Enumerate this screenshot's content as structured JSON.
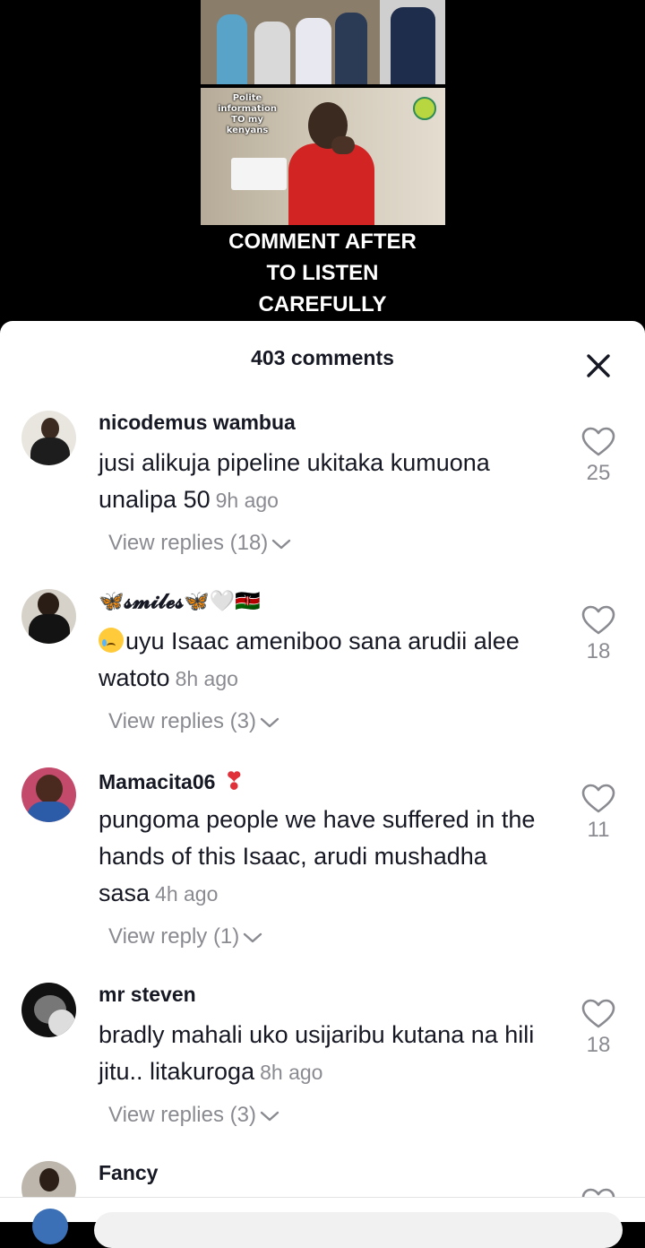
{
  "video": {
    "thumb_top_alt": "",
    "overlay_title_line1": "Polite information",
    "overlay_title_line2": "TO my kenyans",
    "caption_lines": [
      "COMMENT AFTER",
      "TO LISTEN",
      "CAREFULLY"
    ]
  },
  "sheet": {
    "title": "403 comments",
    "close_icon": "close-icon"
  },
  "comments": [
    {
      "username": "nicodemus  wambua",
      "text": "jusi alikuja pipeline ukitaka kumuona unalipa 50",
      "time": "9h ago",
      "replies_label": "View replies (18)",
      "likes": "25"
    },
    {
      "username": "🦋𝓼𝓶𝓲𝓵𝓮𝓼🦋🤍🇰🇪",
      "text": "uyu Isaac ameniboo sana arudii alee watoto",
      "time": "8h ago",
      "replies_label": "View replies (3)",
      "likes": "18"
    },
    {
      "username": "Mamacita06",
      "text": "pungoma people we have suffered in the hands of this Isaac, arudi mushadha sasa",
      "time": "4h ago",
      "replies_label": "View reply (1)",
      "likes": "11"
    },
    {
      "username": "mr steven",
      "text": "bradly mahali uko usijaribu kutana na hili jitu.. litakuroga",
      "time": "8h ago",
      "replies_label": "View replies (3)",
      "likes": "18"
    },
    {
      "username": "Fancy",
      "text": "",
      "time": "",
      "replies_label": "",
      "likes": ""
    }
  ],
  "colors": {
    "primary_text": "#161823",
    "secondary_text": "#8a8b91",
    "heart_emoji": "#e0303a"
  }
}
